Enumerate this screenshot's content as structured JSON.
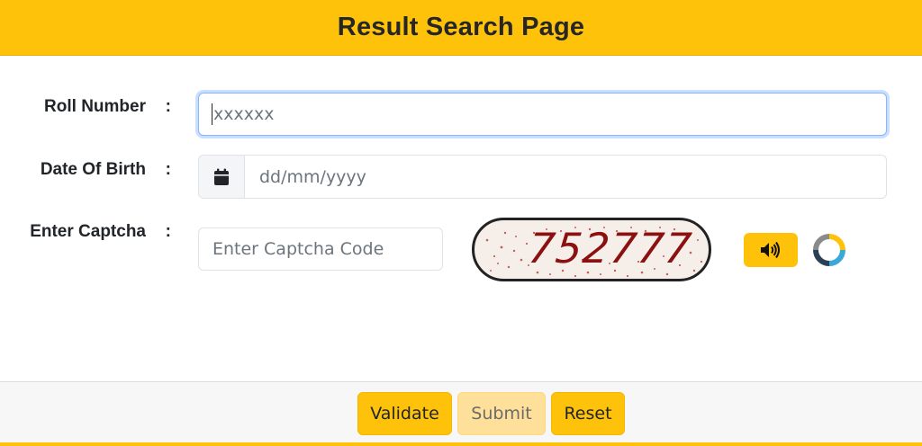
{
  "header": {
    "title": "Result Search Page"
  },
  "form": {
    "roll_number": {
      "label": "Roll Number",
      "colon": ":",
      "value": "xxxxxx"
    },
    "dob": {
      "label": "Date Of Birth",
      "colon": ":",
      "placeholder": "dd/mm/yyyy",
      "icon": "calendar-icon"
    },
    "captcha": {
      "label": "Enter Captcha",
      "colon": ":",
      "placeholder": "Enter Captcha Code",
      "code": "752777",
      "audio_icon": "speaker-icon",
      "refresh_icon": "refresh-icon"
    }
  },
  "buttons": {
    "validate": "Validate",
    "submit": "Submit",
    "reset": "Reset"
  },
  "colors": {
    "accent": "#fec20b",
    "focus": "#86b7fe",
    "captcha_text": "#8b1010"
  }
}
